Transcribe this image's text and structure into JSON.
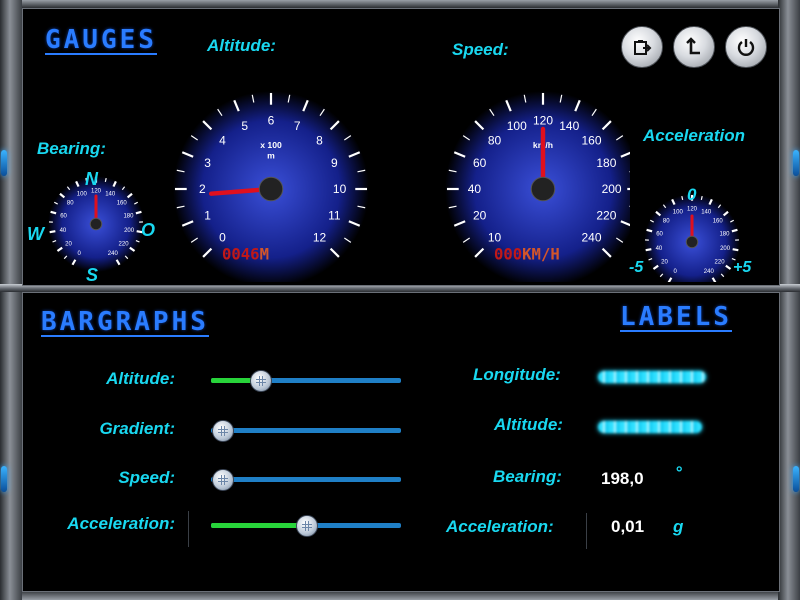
{
  "colors": {
    "accent_blue": "#2a7cff",
    "label_cyan": "#19d8f0",
    "slider_green": "#28d43a",
    "slider_blue": "#1f7fc6",
    "needle_red": "#e0101e",
    "readout_red": "#c01818"
  },
  "header_buttons": [
    {
      "icon": "clipboard-export-icon"
    },
    {
      "icon": "upload-arrow-icon"
    },
    {
      "icon": "power-icon"
    }
  ],
  "gauges": {
    "title": "GAUGES",
    "bearing": {
      "label": "Bearing:",
      "north": "N",
      "south": "S",
      "west": "W",
      "east": "O",
      "ticks": [
        "0",
        "20",
        "40",
        "60",
        "80",
        "100",
        "120",
        "140",
        "160",
        "180",
        "200",
        "220",
        "240"
      ],
      "value": 120
    },
    "altitude": {
      "label": "Altitude:",
      "unit": "x 100\nm",
      "ticks": [
        "0",
        "1",
        "2",
        "3",
        "4",
        "5",
        "6",
        "7",
        "8",
        "9",
        "10",
        "11",
        "12"
      ],
      "value": 1.8,
      "readout_digits": "0046",
      "readout_unit": "M"
    },
    "speed": {
      "label": "Speed:",
      "unit": "km/h",
      "ticks": [
        "10",
        "20",
        "40",
        "60",
        "80",
        "100",
        "120",
        "140",
        "160",
        "180",
        "200",
        "220",
        "240"
      ],
      "value": 125,
      "readout_digits": "000",
      "readout_unit": "KM/H"
    },
    "acceleration": {
      "label": "Acceleration",
      "center": "0",
      "min": "-5",
      "max": "+5",
      "ticks": [
        "0",
        "20",
        "40",
        "60",
        "80",
        "100",
        "120",
        "140",
        "160",
        "180",
        "200",
        "220",
        "240"
      ],
      "value": 120
    }
  },
  "bargraphs": {
    "title": "BARGRAPHS",
    "items": [
      {
        "label": "Altitude:",
        "level": 0.26
      },
      {
        "label": "Gradient:",
        "level": 0.06
      },
      {
        "label": "Speed:",
        "level": 0.06
      },
      {
        "label": "Acceleration:",
        "level": 0.5
      }
    ]
  },
  "labels": {
    "title": "LABELS",
    "rows": [
      {
        "label": "Longitude:",
        "value": "",
        "unit": ""
      },
      {
        "label": "Altitude:",
        "value": "",
        "unit": ""
      },
      {
        "label": "Bearing:",
        "value": "198,0",
        "unit": "°"
      },
      {
        "label": "Acceleration:",
        "value": "0,01",
        "unit": "g"
      }
    ]
  }
}
